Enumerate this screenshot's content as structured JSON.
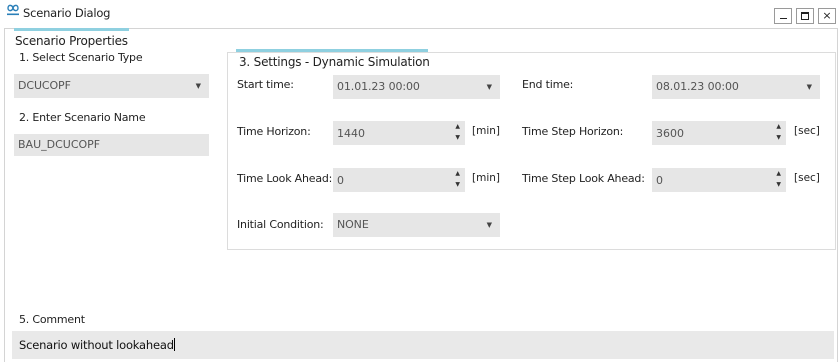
{
  "window": {
    "title": "Scenario Dialog",
    "app_icon": "infinity-logo-icon",
    "controls": {
      "minimize": "minimize-icon",
      "maximize": "maximize-icon",
      "close": "close-icon"
    }
  },
  "colors": {
    "accent": "#8fd0e0",
    "field_bg": "#e6e6e6"
  },
  "properties": {
    "heading": "Scenario Properties",
    "select_type_label": "1. Select Scenario Type",
    "scenario_type": "DCUCOPF",
    "enter_name_label": "2. Enter Scenario Name",
    "scenario_name": "BAU_DCUCOPF"
  },
  "settings": {
    "heading": "3. Settings - Dynamic Simulation",
    "start_time_label": "Start time:",
    "start_time": "01.01.23 00:00",
    "end_time_label": "End time:",
    "end_time": "08.01.23 00:00",
    "time_horizon_label": "Time Horizon:",
    "time_horizon": "1440",
    "time_horizon_unit": "[min]",
    "time_step_horizon_label": "Time Step Horizon:",
    "time_step_horizon": "3600",
    "time_step_horizon_unit": "[sec]",
    "time_look_ahead_label": "Time Look Ahead:",
    "time_look_ahead": "0",
    "time_look_ahead_unit": "[min]",
    "time_step_look_ahead_label": "Time Step Look Ahead:",
    "time_step_look_ahead": "0",
    "time_step_look_ahead_unit": "[sec]",
    "initial_condition_label": "Initial Condition:",
    "initial_condition": "NONE"
  },
  "comment": {
    "label": "5. Comment",
    "value": "Scenario without lookahead"
  }
}
